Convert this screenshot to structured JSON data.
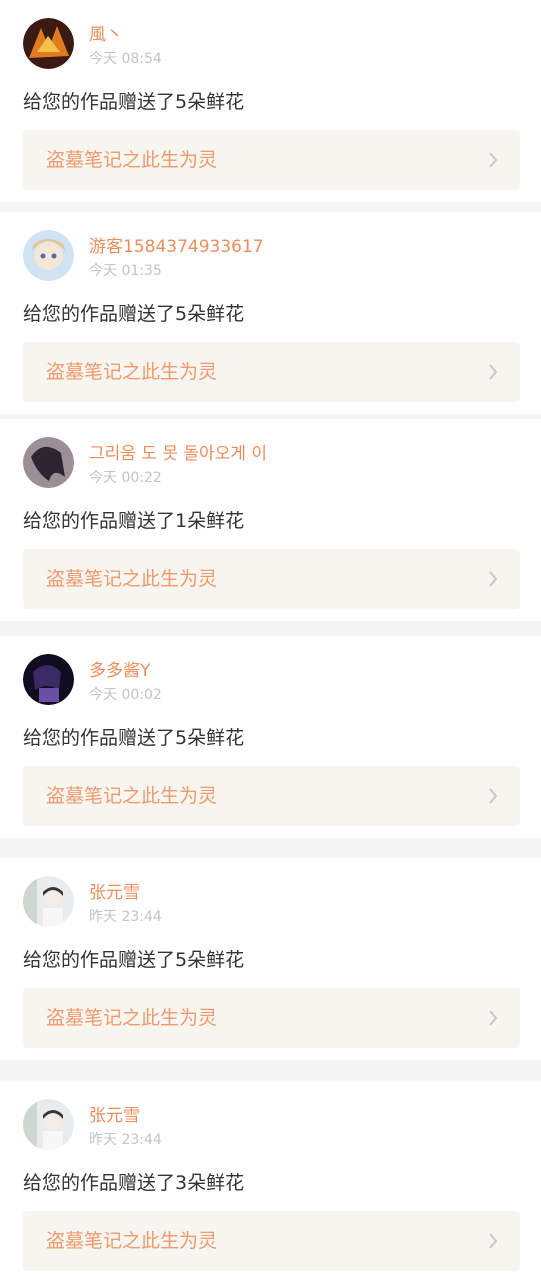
{
  "notifications": [
    {
      "username": "風丶",
      "time": "今天 08:54",
      "message": "给您的作品赠送了5朵鲜花",
      "work_title": "盗墓笔记之此生为灵",
      "avatar_colors": [
        "#e07b1f",
        "#3a1a12"
      ]
    },
    {
      "username": "游客1584374933617",
      "time": "今天 01:35",
      "message": "给您的作品赠送了5朵鲜花",
      "work_title": "盗墓笔记之此生为灵",
      "avatar_colors": [
        "#cfe3f5",
        "#f2d9b8"
      ]
    },
    {
      "username": "그리움 도 못 돌아오게 이",
      "time": "今天 00:22",
      "message": "给您的作品赠送了1朵鲜花",
      "work_title": "盗墓笔记之此生为灵",
      "avatar_colors": [
        "#6b5b66",
        "#2c2430"
      ]
    },
    {
      "username": "多多酱Y",
      "time": "今天 00:02",
      "message": "给您的作品赠送了5朵鲜花",
      "work_title": "盗墓笔记之此生为灵",
      "avatar_colors": [
        "#3b2a66",
        "#0f0c20"
      ]
    },
    {
      "username": "张元雪",
      "time": "昨天 23:44",
      "message": "给您的作品赠送了5朵鲜花",
      "work_title": "盗墓笔记之此生为灵",
      "avatar_colors": [
        "#e9ecec",
        "#cfd6d2"
      ]
    },
    {
      "username": "张元雪",
      "time": "昨天 23:44",
      "message": "给您的作品赠送了3朵鲜花",
      "work_title": "盗墓笔记之此生为灵",
      "avatar_colors": [
        "#e9ecec",
        "#cfd6d2"
      ]
    }
  ],
  "colors": {
    "username": "#ec8e5c",
    "work_title": "#ef9a6c",
    "timestamp": "#c4c4c4",
    "message": "#333333",
    "link_bg": "#f6f5f0",
    "divider": "#f5f5f5"
  },
  "icons": {
    "avatar": "user-avatar",
    "link_arrow": "chevron-right-icon"
  }
}
